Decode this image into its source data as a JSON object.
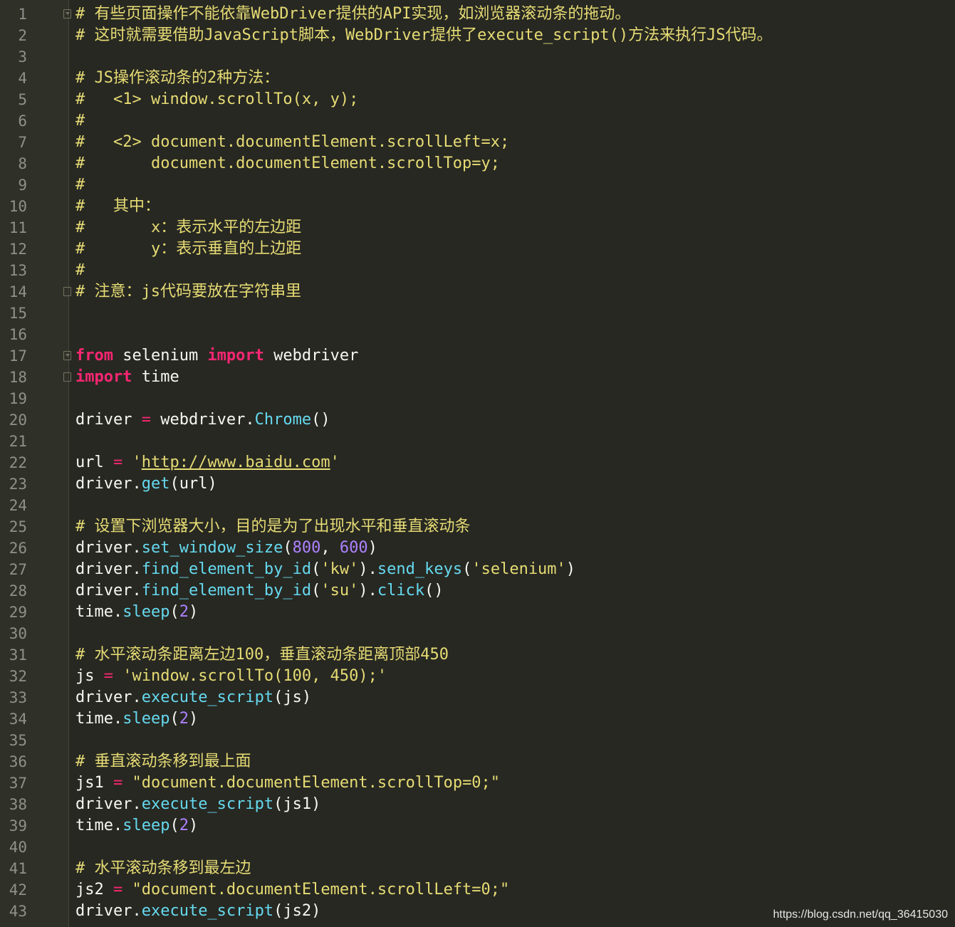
{
  "editor": {
    "lines": [
      {
        "n": "1",
        "fold": "open",
        "tokens": [
          {
            "t": "# 有些页面操作不能依靠WebDriver提供的API实现，如浏览器滚动条的拖动。",
            "c": "comment"
          }
        ]
      },
      {
        "n": "2",
        "tokens": [
          {
            "t": "# 这时就需要借助JavaScript脚本，WebDriver提供了execute_script()方法来执行JS代码。",
            "c": "comment"
          }
        ]
      },
      {
        "n": "3",
        "tokens": []
      },
      {
        "n": "4",
        "tokens": [
          {
            "t": "# JS操作滚动条的2种方法：",
            "c": "comment"
          }
        ]
      },
      {
        "n": "5",
        "tokens": [
          {
            "t": "#   <1> window.scrollTo(x, y);",
            "c": "comment"
          }
        ]
      },
      {
        "n": "6",
        "tokens": [
          {
            "t": "#",
            "c": "comment"
          }
        ]
      },
      {
        "n": "7",
        "tokens": [
          {
            "t": "#   <2> document.documentElement.scrollLeft=x;",
            "c": "comment"
          }
        ]
      },
      {
        "n": "8",
        "tokens": [
          {
            "t": "#       document.documentElement.scrollTop=y;",
            "c": "comment"
          }
        ]
      },
      {
        "n": "9",
        "tokens": [
          {
            "t": "#",
            "c": "comment"
          }
        ]
      },
      {
        "n": "10",
        "tokens": [
          {
            "t": "#   其中：",
            "c": "comment"
          }
        ]
      },
      {
        "n": "11",
        "tokens": [
          {
            "t": "#       x：表示水平的左边距",
            "c": "comment"
          }
        ]
      },
      {
        "n": "12",
        "tokens": [
          {
            "t": "#       y：表示垂直的上边距",
            "c": "comment"
          }
        ]
      },
      {
        "n": "13",
        "tokens": [
          {
            "t": "#",
            "c": "comment"
          }
        ]
      },
      {
        "n": "14",
        "fold": "close",
        "tokens": [
          {
            "t": "# 注意：js代码要放在字符串里",
            "c": "comment"
          }
        ]
      },
      {
        "n": "15",
        "tokens": []
      },
      {
        "n": "16",
        "tokens": []
      },
      {
        "n": "17",
        "fold": "open",
        "tokens": [
          {
            "t": "from",
            "c": "kw"
          },
          {
            "t": " selenium ",
            "c": "txt"
          },
          {
            "t": "import",
            "c": "kw"
          },
          {
            "t": " webdriver",
            "c": "txt"
          }
        ]
      },
      {
        "n": "18",
        "fold": "close",
        "tokens": [
          {
            "t": "import",
            "c": "kw"
          },
          {
            "t": " time",
            "c": "txt"
          }
        ]
      },
      {
        "n": "19",
        "tokens": []
      },
      {
        "n": "20",
        "tokens": [
          {
            "t": "driver ",
            "c": "txt"
          },
          {
            "t": "=",
            "c": "op"
          },
          {
            "t": " webdriver.",
            "c": "txt"
          },
          {
            "t": "Chrome",
            "c": "fn"
          },
          {
            "t": "()",
            "c": "txt"
          }
        ]
      },
      {
        "n": "21",
        "tokens": []
      },
      {
        "n": "22",
        "tokens": [
          {
            "t": "url ",
            "c": "txt"
          },
          {
            "t": "=",
            "c": "op"
          },
          {
            "t": " '",
            "c": "str"
          },
          {
            "t": "http://www.baidu.com",
            "c": "url"
          },
          {
            "t": "'",
            "c": "str"
          }
        ]
      },
      {
        "n": "23",
        "tokens": [
          {
            "t": "driver.",
            "c": "txt"
          },
          {
            "t": "get",
            "c": "fn"
          },
          {
            "t": "(url)",
            "c": "txt"
          }
        ]
      },
      {
        "n": "24",
        "tokens": []
      },
      {
        "n": "25",
        "tokens": [
          {
            "t": "# 设置下浏览器大小，目的是为了出现水平和垂直滚动条",
            "c": "comment"
          }
        ]
      },
      {
        "n": "26",
        "tokens": [
          {
            "t": "driver.",
            "c": "txt"
          },
          {
            "t": "set_window_size",
            "c": "fn"
          },
          {
            "t": "(",
            "c": "txt"
          },
          {
            "t": "800",
            "c": "num"
          },
          {
            "t": ", ",
            "c": "txt"
          },
          {
            "t": "600",
            "c": "num"
          },
          {
            "t": ")",
            "c": "txt"
          }
        ]
      },
      {
        "n": "27",
        "tokens": [
          {
            "t": "driver.",
            "c": "txt"
          },
          {
            "t": "find_element_by_id",
            "c": "fn"
          },
          {
            "t": "(",
            "c": "txt"
          },
          {
            "t": "'kw'",
            "c": "str"
          },
          {
            "t": ").",
            "c": "txt"
          },
          {
            "t": "send_keys",
            "c": "fn"
          },
          {
            "t": "(",
            "c": "txt"
          },
          {
            "t": "'selenium'",
            "c": "str"
          },
          {
            "t": ")",
            "c": "txt"
          }
        ]
      },
      {
        "n": "28",
        "tokens": [
          {
            "t": "driver.",
            "c": "txt"
          },
          {
            "t": "find_element_by_id",
            "c": "fn"
          },
          {
            "t": "(",
            "c": "txt"
          },
          {
            "t": "'su'",
            "c": "str"
          },
          {
            "t": ").",
            "c": "txt"
          },
          {
            "t": "click",
            "c": "fn"
          },
          {
            "t": "()",
            "c": "txt"
          }
        ]
      },
      {
        "n": "29",
        "tokens": [
          {
            "t": "time.",
            "c": "txt"
          },
          {
            "t": "sleep",
            "c": "fn"
          },
          {
            "t": "(",
            "c": "txt"
          },
          {
            "t": "2",
            "c": "num"
          },
          {
            "t": ")",
            "c": "txt"
          }
        ]
      },
      {
        "n": "30",
        "tokens": []
      },
      {
        "n": "31",
        "tokens": [
          {
            "t": "# 水平滚动条距离左边100，垂直滚动条距离顶部450",
            "c": "comment"
          }
        ]
      },
      {
        "n": "32",
        "tokens": [
          {
            "t": "js ",
            "c": "txt"
          },
          {
            "t": "=",
            "c": "op"
          },
          {
            "t": " ",
            "c": "txt"
          },
          {
            "t": "'window.scrollTo(100, 450);'",
            "c": "str"
          }
        ]
      },
      {
        "n": "33",
        "tokens": [
          {
            "t": "driver.",
            "c": "txt"
          },
          {
            "t": "execute_script",
            "c": "fn"
          },
          {
            "t": "(js)",
            "c": "txt"
          }
        ]
      },
      {
        "n": "34",
        "tokens": [
          {
            "t": "time.",
            "c": "txt"
          },
          {
            "t": "sleep",
            "c": "fn"
          },
          {
            "t": "(",
            "c": "txt"
          },
          {
            "t": "2",
            "c": "num"
          },
          {
            "t": ")",
            "c": "txt"
          }
        ]
      },
      {
        "n": "35",
        "tokens": []
      },
      {
        "n": "36",
        "tokens": [
          {
            "t": "# 垂直滚动条移到最上面",
            "c": "comment"
          }
        ]
      },
      {
        "n": "37",
        "tokens": [
          {
            "t": "js1 ",
            "c": "txt"
          },
          {
            "t": "=",
            "c": "op"
          },
          {
            "t": " ",
            "c": "txt"
          },
          {
            "t": "\"document.documentElement.scrollTop=0;\"",
            "c": "str"
          }
        ]
      },
      {
        "n": "38",
        "tokens": [
          {
            "t": "driver.",
            "c": "txt"
          },
          {
            "t": "execute_script",
            "c": "fn"
          },
          {
            "t": "(js1)",
            "c": "txt"
          }
        ]
      },
      {
        "n": "39",
        "tokens": [
          {
            "t": "time.",
            "c": "txt"
          },
          {
            "t": "sleep",
            "c": "fn"
          },
          {
            "t": "(",
            "c": "txt"
          },
          {
            "t": "2",
            "c": "num"
          },
          {
            "t": ")",
            "c": "txt"
          }
        ]
      },
      {
        "n": "40",
        "tokens": []
      },
      {
        "n": "41",
        "tokens": [
          {
            "t": "# 水平滚动条移到最左边",
            "c": "comment"
          }
        ]
      },
      {
        "n": "42",
        "tokens": [
          {
            "t": "js2 ",
            "c": "txt"
          },
          {
            "t": "=",
            "c": "op"
          },
          {
            "t": " ",
            "c": "txt"
          },
          {
            "t": "\"document.documentElement.scrollLeft=0;\"",
            "c": "str"
          }
        ]
      },
      {
        "n": "43",
        "tokens": [
          {
            "t": "driver.",
            "c": "txt"
          },
          {
            "t": "execute_script",
            "c": "fn"
          },
          {
            "t": "(js2)",
            "c": "txt"
          }
        ]
      }
    ]
  },
  "watermark": "https://blog.csdn.net/qq_36415030",
  "colors": {
    "background": "#272822",
    "gutter": "#2f3129",
    "comment": "#e6db74",
    "keyword": "#f92672",
    "function": "#66d9ef",
    "number": "#ae81ff",
    "text": "#f8f8f2"
  }
}
